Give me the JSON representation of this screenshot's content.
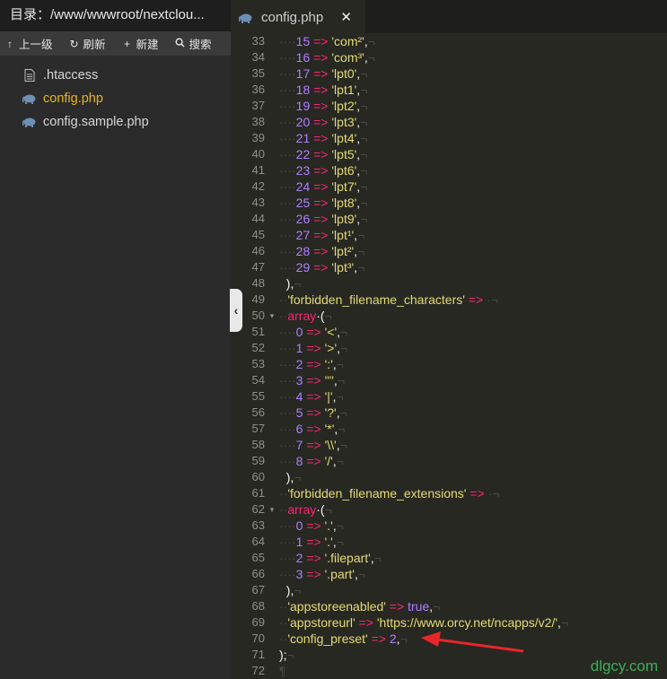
{
  "sidebar": {
    "dir_label": "目录：/www/wwwroot/nextclou...",
    "toolbar": {
      "up": "上一级",
      "refresh": "刷新",
      "new": "新建",
      "search": "搜索"
    },
    "files": [
      {
        "name": ".htaccess",
        "icon": "document-icon",
        "active": false
      },
      {
        "name": "config.php",
        "icon": "php-elephant-icon",
        "active": true
      },
      {
        "name": "config.sample.php",
        "icon": "php-elephant-icon",
        "active": false
      }
    ]
  },
  "editor": {
    "tab_title": "config.php",
    "line_numbers": [
      "33",
      "34",
      "35",
      "36",
      "37",
      "38",
      "39",
      "40",
      "41",
      "42",
      "43",
      "44",
      "45",
      "46",
      "47",
      "48",
      "49",
      "50",
      "51",
      "52",
      "53",
      "54",
      "55",
      "56",
      "57",
      "58",
      "59",
      "60",
      "61",
      "62",
      "63",
      "64",
      "65",
      "66",
      "67",
      "68",
      "69",
      "70",
      "71",
      "72"
    ],
    "fold_lines": [
      "50",
      "62"
    ],
    "code": [
      {
        "ind": "····",
        "k": "15",
        "v": "'com²'"
      },
      {
        "ind": "····",
        "k": "16",
        "v": "'com³'"
      },
      {
        "ind": "····",
        "k": "17",
        "v": "'lpt0'"
      },
      {
        "ind": "····",
        "k": "18",
        "v": "'lpt1'"
      },
      {
        "ind": "····",
        "k": "19",
        "v": "'lpt2'"
      },
      {
        "ind": "····",
        "k": "20",
        "v": "'lpt3'"
      },
      {
        "ind": "····",
        "k": "21",
        "v": "'lpt4'"
      },
      {
        "ind": "····",
        "k": "22",
        "v": "'lpt5'"
      },
      {
        "ind": "····",
        "k": "23",
        "v": "'lpt6'"
      },
      {
        "ind": "····",
        "k": "24",
        "v": "'lpt7'"
      },
      {
        "ind": "····",
        "k": "25",
        "v": "'lpt8'"
      },
      {
        "ind": "····",
        "k": "26",
        "v": "'lpt9'"
      },
      {
        "ind": "····",
        "k": "27",
        "v": "'lpt¹'"
      },
      {
        "ind": "····",
        "k": "28",
        "v": "'lpt²'"
      },
      {
        "ind": "····",
        "k": "29",
        "v": "'lpt³'"
      },
      {
        "raw": "··),"
      },
      {
        "ind": "··",
        "ks": "'forbidden_filename_characters'",
        "arrow_only": true
      },
      {
        "ind": "··",
        "kw": "array",
        "tail": "·("
      },
      {
        "ind": "····",
        "k": "0",
        "v": "'<'"
      },
      {
        "ind": "····",
        "k": "1",
        "v": "'>'"
      },
      {
        "ind": "····",
        "k": "2",
        "v": "':'"
      },
      {
        "ind": "····",
        "k": "3",
        "v": "'\"'"
      },
      {
        "ind": "····",
        "k": "4",
        "v": "'|'"
      },
      {
        "ind": "····",
        "k": "5",
        "v": "'?'"
      },
      {
        "ind": "····",
        "k": "6",
        "v": "'*'"
      },
      {
        "ind": "····",
        "k": "7",
        "v": "'\\\\'"
      },
      {
        "ind": "····",
        "k": "8",
        "v": "'/'"
      },
      {
        "raw": "··),"
      },
      {
        "ind": "··",
        "ks": "'forbidden_filename_extensions'",
        "arrow_only": true
      },
      {
        "ind": "··",
        "kw": "array",
        "tail": "·("
      },
      {
        "ind": "····",
        "k": "0",
        "v": "'.'"
      },
      {
        "ind": "····",
        "k": "1",
        "v": "'.'"
      },
      {
        "ind": "····",
        "k": "2",
        "v": "'.filepart'"
      },
      {
        "ind": "····",
        "k": "3",
        "v": "'.part'"
      },
      {
        "raw": "··),"
      },
      {
        "ind": "··",
        "ks": "'appstoreenabled'",
        "c": "true"
      },
      {
        "ind": "··",
        "ks": "'appstoreurl'",
        "v": "'https://www.orcy.net/ncapps/v2/'"
      },
      {
        "ind": "··",
        "ks": "'config_preset'",
        "n": "2"
      },
      {
        "raw": ");"
      },
      {
        "raw": "",
        "eof": "¶"
      }
    ]
  },
  "watermark": "dlgcy.com",
  "colors": {
    "string": "#e6db74",
    "number": "#ae81ff",
    "operator": "#f92672",
    "annotation_arrow": "#e8262a",
    "active_file": "#e6b422"
  }
}
